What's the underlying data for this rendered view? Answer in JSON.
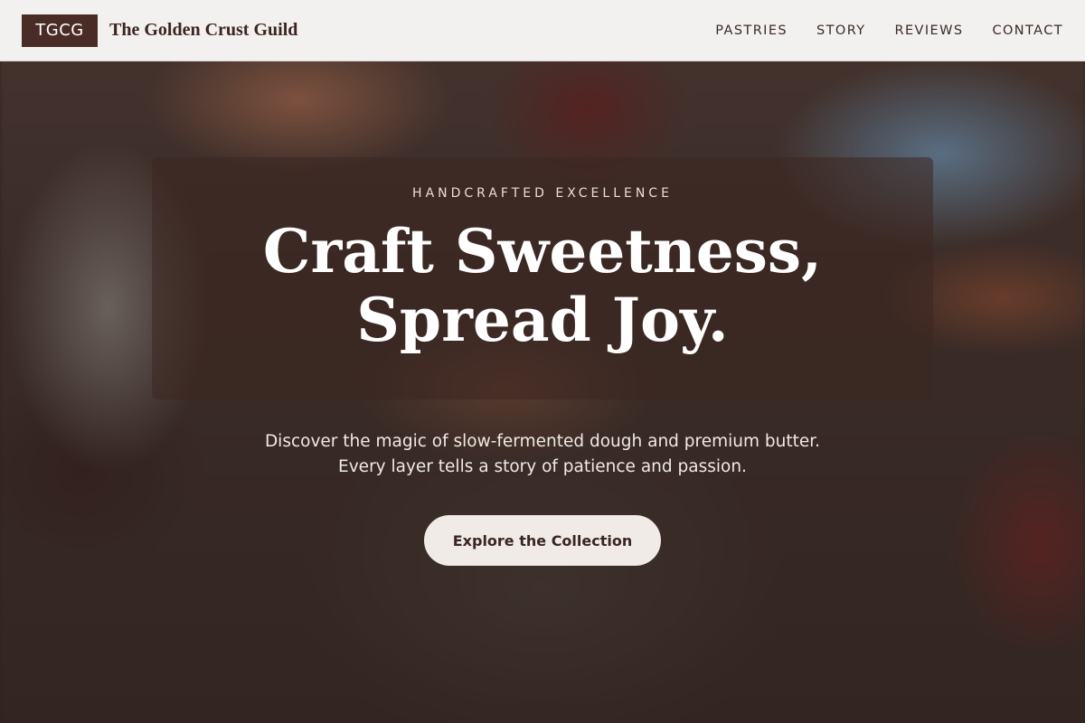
{
  "header": {
    "logo_text": "TGCG",
    "brand_name": "The Golden Crust Guild",
    "nav": [
      {
        "label": "PASTRIES"
      },
      {
        "label": "STORY"
      },
      {
        "label": "REVIEWS"
      },
      {
        "label": "CONTACT"
      }
    ]
  },
  "hero": {
    "eyebrow": "HANDCRAFTED EXCELLENCE",
    "title_line1": "Craft Sweetness,",
    "title_line2": "Spread Joy.",
    "description_line1": "Discover the magic of slow-fermented dough and premium butter.",
    "description_line2": "Every layer tells a story of patience and passion.",
    "cta_label": "Explore the Collection"
  },
  "colors": {
    "brand_dark": "#4a2c26",
    "header_bg": "#f3f1f0",
    "cta_bg": "#f1ebe8"
  }
}
